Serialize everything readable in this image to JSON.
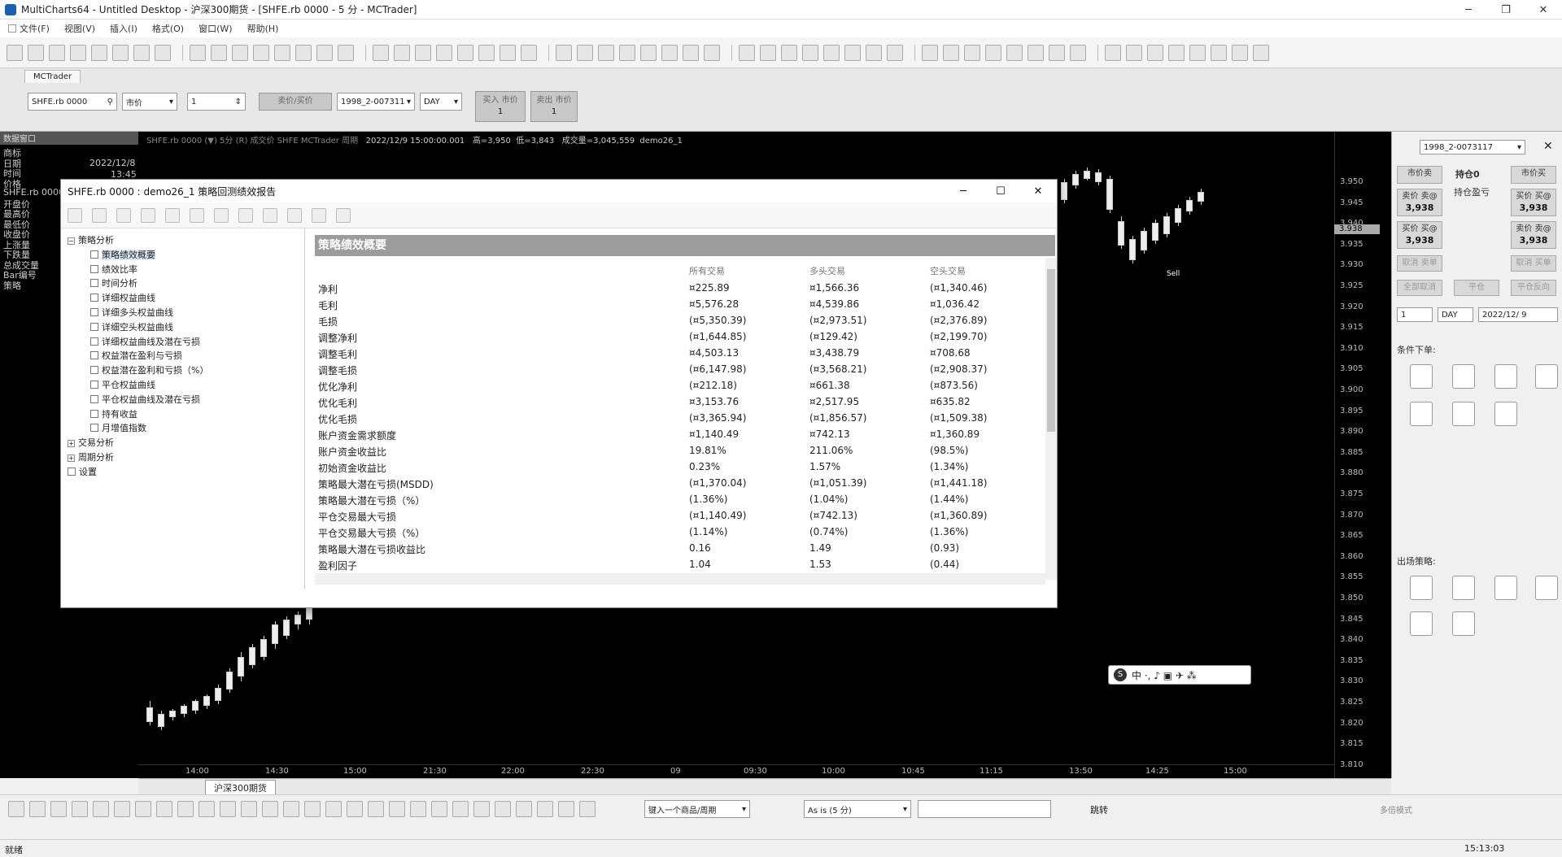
{
  "window": {
    "title": "MultiCharts64 - Untitled Desktop - 沪深300期货 - [SHFE.rb 0000 - 5 分 - MCTrader]"
  },
  "menu": [
    "文件(F)",
    "视图(V)",
    "插入(I)",
    "格式(O)",
    "窗口(W)",
    "帮助(H)"
  ],
  "mctrader_tab": "MCTrader",
  "order_bar": {
    "symbol": "SHFE.rb 0000",
    "order_type": "市价",
    "quantity": "1",
    "buy_sell": "卖价/买价",
    "account": "1998_2-007311",
    "tif": "DAY",
    "buy_label": "买入 市价",
    "buy_qty": "1",
    "sell_label": "卖出 市价",
    "sell_qty": "1"
  },
  "left_panel": {
    "header": "数据窗口",
    "labels": [
      "商标",
      "日期",
      "时间",
      "价格",
      "SHFE.rb 0000",
      "开盘价",
      "最高价",
      "最低价",
      "收盘价",
      "上涨量",
      "下跌量",
      "总成交量",
      "Bar编号",
      "策略"
    ],
    "date": "2022/12/8",
    "time": "13:45"
  },
  "chart": {
    "info_prefix": "SHFE.rb 0000 (▼) 5分 (R) 成交价 SHFE MCTrader 周期",
    "info_date": "2022/12/9  15:00:00.001",
    "info_high": "高=3,950",
    "info_low": "低=3,843",
    "info_vol": "成交量=3,045,559",
    "info_strategy": "demo26_1",
    "price_labels": [
      "3.950",
      "3.945",
      "3.940",
      "3.935",
      "3.930",
      "3.925",
      "3.920",
      "3.915",
      "3.910",
      "3.905",
      "3.900",
      "3.895",
      "3.890",
      "3.885",
      "3.880",
      "3.875",
      "3.870",
      "3.865",
      "3.860",
      "3.855",
      "3.850",
      "3.845",
      "3.840",
      "3.835",
      "3.830",
      "3.825",
      "3.820",
      "3.815",
      "3.810"
    ],
    "current_price": "3.938",
    "time_labels": [
      "14:00",
      "14:30",
      "15:00",
      "21:30",
      "22:00",
      "22:30",
      "09",
      "09:30",
      "10:00",
      "10:45",
      "11:15",
      "13:50",
      "14:25",
      "15:00"
    ],
    "sell_marker": "Sell"
  },
  "dialog": {
    "title": "SHFE.rb 0000 : demo26_1 策略回测绩效报告",
    "tree": [
      {
        "label": "策略分析",
        "level": 0,
        "type": "folder"
      },
      {
        "label": "策略绩效概要",
        "level": 1,
        "type": "page",
        "selected": true
      },
      {
        "label": "绩效比率",
        "level": 1,
        "type": "page"
      },
      {
        "label": "时间分析",
        "level": 1,
        "type": "page"
      },
      {
        "label": "详细权益曲线",
        "level": 1,
        "type": "chart"
      },
      {
        "label": "详细多头权益曲线",
        "level": 1,
        "type": "chart"
      },
      {
        "label": "详细空头权益曲线",
        "level": 1,
        "type": "chart"
      },
      {
        "label": "详细权益曲线及潜在亏损",
        "level": 1,
        "type": "chart"
      },
      {
        "label": "权益潜在盈利与亏损",
        "level": 1,
        "type": "chart"
      },
      {
        "label": "权益潜在盈利和亏损（%）",
        "level": 1,
        "type": "chart"
      },
      {
        "label": "平仓权益曲线",
        "level": 1,
        "type": "chart"
      },
      {
        "label": "平仓权益曲线及潜在亏损",
        "level": 1,
        "type": "chart"
      },
      {
        "label": "持有收益",
        "level": 1,
        "type": "chart"
      },
      {
        "label": "月增值指数",
        "level": 1,
        "type": "page"
      },
      {
        "label": "交易分析",
        "level": 0,
        "type": "folder"
      },
      {
        "label": "周期分析",
        "level": 0,
        "type": "folder"
      },
      {
        "label": "设置",
        "level": 0,
        "type": "page"
      }
    ],
    "report_header": "策略绩效概要",
    "columns": [
      "所有交易",
      "多头交易",
      "空头交易"
    ],
    "rows": [
      [
        "净利",
        "¤225.89",
        "¤1,566.36",
        "(¤1,340.46)"
      ],
      [
        "毛利",
        "¤5,576.28",
        "¤4,539.86",
        "¤1,036.42"
      ],
      [
        "毛损",
        "(¤5,350.39)",
        "(¤2,973.51)",
        "(¤2,376.89)"
      ],
      [
        "调整净利",
        "(¤1,644.85)",
        "(¤129.42)",
        "(¤2,199.70)"
      ],
      [
        "调整毛利",
        "¤4,503.13",
        "¤3,438.79",
        "¤708.68"
      ],
      [
        "调整毛损",
        "(¤6,147.98)",
        "(¤3,568.21)",
        "(¤2,908.37)"
      ],
      [
        "优化净利",
        "(¤212.18)",
        "¤661.38",
        "(¤873.56)"
      ],
      [
        "优化毛利",
        "¤3,153.76",
        "¤2,517.95",
        "¤635.82"
      ],
      [
        "优化毛损",
        "(¤3,365.94)",
        "(¤1,856.57)",
        "(¤1,509.38)"
      ],
      [
        "账户资金需求额度",
        "¤1,140.49",
        "¤742.13",
        "¤1,360.89"
      ],
      [
        "账户资金收益比",
        "19.81%",
        "211.06%",
        "(98.5%)"
      ],
      [
        "初始资金收益比",
        "0.23%",
        "1.57%",
        "(1.34%)"
      ],
      [
        "策略最大潜在亏损(MSDD)",
        "(¤1,370.04)",
        "(¤1,051.39)",
        "(¤1,441.18)"
      ],
      [
        "策略最大潜在亏损（%）",
        "(1.36%)",
        "(1.04%)",
        "(1.44%)"
      ],
      [
        "平仓交易最大亏损",
        "(¤1,140.49)",
        "(¤742.13)",
        "(¤1,360.89)"
      ],
      [
        "平仓交易最大亏损（%）",
        "(1.14%)",
        "(0.74%)",
        "(1.36%)"
      ],
      [
        "策略最大潜在亏损收益比",
        "0.16",
        "1.49",
        "(0.93)"
      ],
      [
        "盈利因子",
        "1.04",
        "1.53",
        "(0.44)"
      ]
    ]
  },
  "right_panel": {
    "account": "1998_2-0073117",
    "sell_market": "市价卖",
    "position": "持仓0",
    "position_pnl": "持仓盈亏",
    "buy_market": "市价买",
    "sell_bid_label": "卖价 卖@",
    "sell_bid": "3,938",
    "buy_ask_label": "买价 买@",
    "buy_ask": "3,938",
    "cancel_sell": "取消 卖单",
    "cancel_buy": "取消 买单",
    "cancel_all": "全部取消",
    "flatten": "平仓",
    "reverse": "平仓反向",
    "qty": "1",
    "tif": "DAY",
    "date": "2022/12/ 9",
    "conditional_label": "条件下单:",
    "exit_label": "出场策略:"
  },
  "bottom": {
    "sheet_tab": "沪深300期货",
    "symbol_input_placeholder": "键入一个商品/周期",
    "resolution": "As is (5 分)",
    "jump_label": "跳转",
    "multi_mode": "多倍模式"
  },
  "status": {
    "left": "就绪",
    "time": "15:13:03"
  },
  "ime": {
    "text": "中 ·, ♪ ▣ ✈ ⁂"
  }
}
